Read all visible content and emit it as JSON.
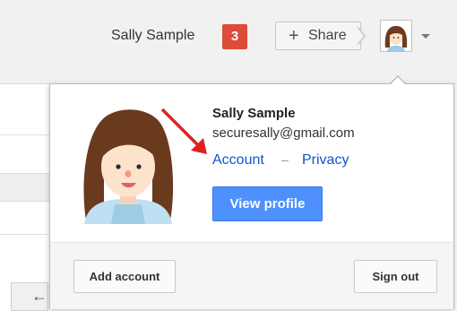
{
  "header": {
    "user_name": "Sally Sample",
    "notification_count": "3",
    "share_label": "Share",
    "share_icon": "plus-icon",
    "avatar_icon": "avatar-icon",
    "menu_icon": "chevron-down-icon",
    "notification_color": "#dd4b39"
  },
  "background_page": {
    "back_icon": "arrow-left-icon"
  },
  "account_popup": {
    "name": "Sally Sample",
    "email": "securesally@gmail.com",
    "account_link": "Account",
    "separator": "–",
    "privacy_link": "Privacy",
    "view_profile_label": "View profile",
    "add_account_label": "Add account",
    "sign_out_label": "Sign out",
    "link_color": "#1155cc",
    "primary_button_color": "#4d90fe",
    "annotation_arrow_icon": "red-arrow-icon",
    "annotation_color": "#e02020"
  }
}
